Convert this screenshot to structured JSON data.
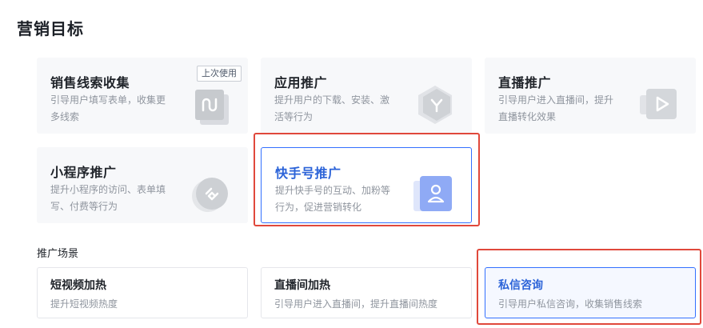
{
  "page": {
    "title": "营销目标"
  },
  "goals": [
    {
      "title": "销售线索收集",
      "desc": "引导用户填写表单，收集更多线索",
      "tag": "上次使用",
      "icon": "form-icon"
    },
    {
      "title": "应用推广",
      "desc": "提升用户的下载、安装、激活等行为",
      "icon": "app-icon"
    },
    {
      "title": "直播推广",
      "desc": "引导用户进入直播间，提升直播转化效果",
      "icon": "live-play-icon"
    },
    {
      "title": "小程序推广",
      "desc": "提升小程序的访问、表单填写、付费等行为",
      "icon": "mini-program-icon"
    },
    {
      "title": "快手号推广",
      "desc": "提升快手号的互动、加粉等行为，促进营销转化",
      "icon": "user-account-icon"
    }
  ],
  "scenes": {
    "label": "推广场景",
    "items": [
      {
        "title": "短视频加热",
        "desc": "提升短视频热度"
      },
      {
        "title": "直播间加热",
        "desc": "引导用户进入直播间，提升直播间热度"
      },
      {
        "title": "私信咨询",
        "desc": "引导用户私信咨询，收集销售线索"
      }
    ]
  },
  "colors": {
    "accent": "#3370ff",
    "accent_text": "#2b63d8",
    "highlight": "#e0483b",
    "card_bg": "#f7f8fa"
  }
}
